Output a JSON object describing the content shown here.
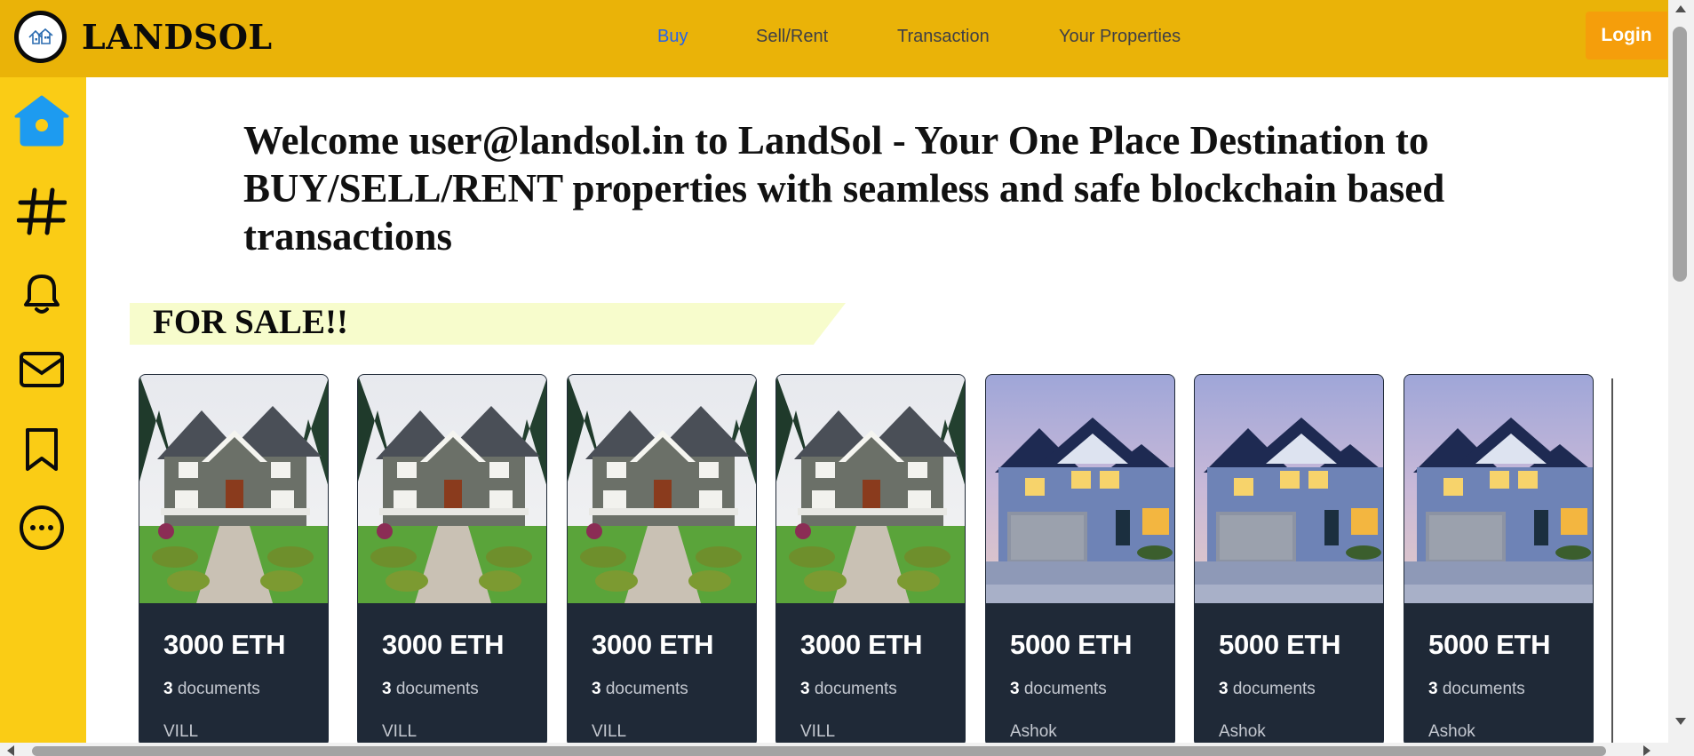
{
  "header": {
    "brand": "LANDSOL",
    "nav": [
      {
        "label": "Buy",
        "active": true
      },
      {
        "label": "Sell/Rent",
        "active": false
      },
      {
        "label": "Transaction",
        "active": false
      },
      {
        "label": "Your Properties",
        "active": false
      }
    ],
    "login_label": "Login"
  },
  "sidebar": {
    "icons": [
      "home-icon",
      "hashtag-icon",
      "bell-icon",
      "mail-icon",
      "bookmark-icon",
      "more-icon"
    ]
  },
  "main": {
    "welcome": "Welcome user@landsol.in to LandSol - Your One Place Destination to BUY/SELL/RENT properties with seamless and safe blockchain based transactions",
    "section_title": "FOR SALE!!",
    "listings": [
      {
        "price": "3000 ETH",
        "doc_count": "3",
        "doc_label": "documents",
        "owner": "VILL",
        "image": "gray-craftsman-house"
      },
      {
        "price": "3000 ETH",
        "doc_count": "3",
        "doc_label": "documents",
        "owner": "VILL",
        "image": "gray-craftsman-house"
      },
      {
        "price": "3000 ETH",
        "doc_count": "3",
        "doc_label": "documents",
        "owner": "VILL",
        "image": "gray-craftsman-house"
      },
      {
        "price": "3000 ETH",
        "doc_count": "3",
        "doc_label": "documents",
        "owner": "VILL",
        "image": "gray-craftsman-house"
      },
      {
        "price": "5000 ETH",
        "doc_count": "3",
        "doc_label": "documents",
        "owner": "Ashok",
        "image": "blue-house-dusk"
      },
      {
        "price": "5000 ETH",
        "doc_count": "3",
        "doc_label": "documents",
        "owner": "Ashok",
        "image": "blue-house-dusk"
      },
      {
        "price": "5000 ETH",
        "doc_count": "3",
        "doc_label": "documents",
        "owner": "Ashok",
        "image": "blue-house-dusk"
      }
    ]
  },
  "colors": {
    "header_bg": "#eab308",
    "sidebar_bg": "#facc15",
    "accent_blue": "#2563eb",
    "login_bg": "#f59e0b",
    "card_bg": "#1f2937",
    "banner_bg": "#f7fccc"
  }
}
